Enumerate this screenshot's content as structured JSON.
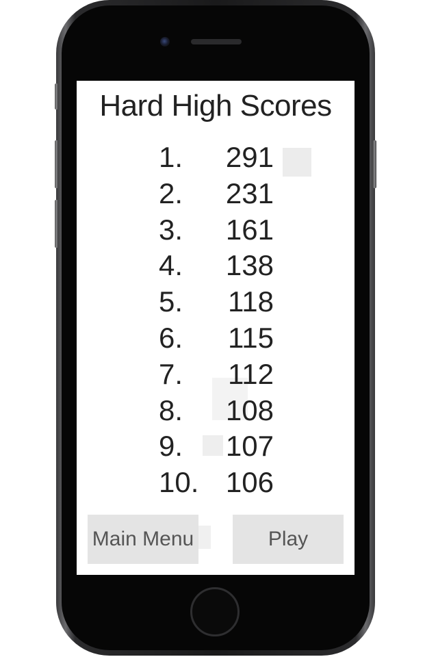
{
  "screen": {
    "title": "Hard High Scores",
    "scores": [
      {
        "rank": "1.",
        "score": "291"
      },
      {
        "rank": "2.",
        "score": "231"
      },
      {
        "rank": "3.",
        "score": "161"
      },
      {
        "rank": "4.",
        "score": "138"
      },
      {
        "rank": "5.",
        "score": "118"
      },
      {
        "rank": "6.",
        "score": "115"
      },
      {
        "rank": "7.",
        "score": "112"
      },
      {
        "rank": "8.",
        "score": "108"
      },
      {
        "rank": "9.",
        "score": "107"
      },
      {
        "rank": "10.",
        "score": "106"
      }
    ],
    "main_menu_label": "Main Menu",
    "play_label": "Play"
  },
  "colors": {
    "background": "#ffffff",
    "text": "#222222",
    "button_bg": "#e4e4e4",
    "button_text": "#555555",
    "device_frame": "#1a1a1b"
  }
}
